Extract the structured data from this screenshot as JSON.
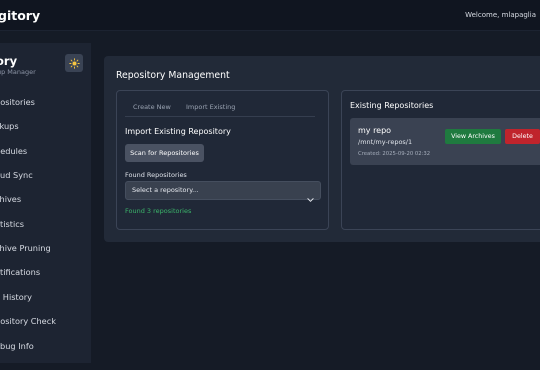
{
  "header": {
    "brand": "gitory",
    "welcome": "Welcome, mlapaglia"
  },
  "sidebar": {
    "title": "ory",
    "subtitle": "up Manager",
    "theme_icon": "sun-icon",
    "items": [
      {
        "label": "positories"
      },
      {
        "label": "ckups"
      },
      {
        "label": "hedules"
      },
      {
        "label": "oud Sync"
      },
      {
        "label": "chives"
      },
      {
        "label": "atistics"
      },
      {
        "label": "chive Pruning"
      },
      {
        "label": "otifications"
      },
      {
        "label": "b History"
      },
      {
        "label": "pository Check"
      },
      {
        "label": "ebug Info"
      }
    ]
  },
  "main": {
    "title": "Repository Management",
    "tabs": [
      {
        "label": "Create New"
      },
      {
        "label": "Import Existing"
      }
    ],
    "import": {
      "title": "Import Existing Repository",
      "scan_button": "Scan for Repositories",
      "found_label": "Found Repositories",
      "select_placeholder": "Select a repository...",
      "found_count": "Found 3 repositories"
    },
    "existing": {
      "title": "Existing Repositories",
      "repos": [
        {
          "name": "my repo",
          "path": "/mnt/my-repos/1",
          "created": "Created: 2025-09-20 02:32",
          "view_label": "View Archives",
          "delete_label": "Delete"
        }
      ]
    }
  },
  "colors": {
    "success": "#1f7a3f",
    "danger": "#c0242c",
    "success_text": "#3bb56a"
  }
}
